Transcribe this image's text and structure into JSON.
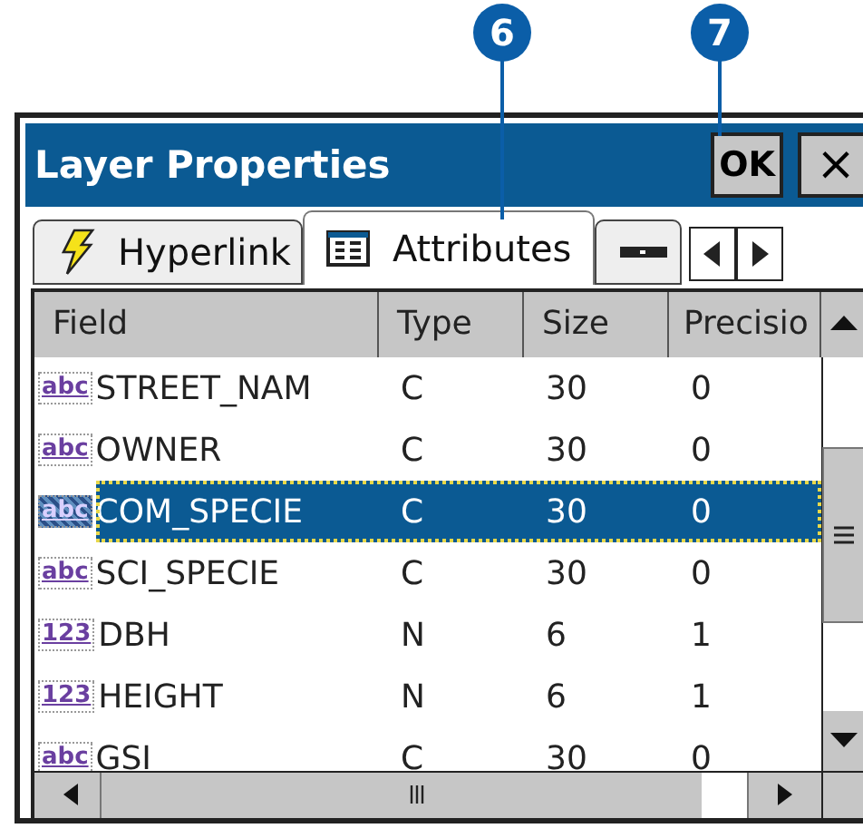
{
  "callouts": [
    {
      "number": "6"
    },
    {
      "number": "7"
    }
  ],
  "window": {
    "title": "Layer Properties",
    "buttons": [
      {
        "label": "OK",
        "kind": "ok"
      },
      {
        "label": "×",
        "kind": "close"
      }
    ]
  },
  "tabs": [
    {
      "label": "Hyperlink",
      "kind": "lightning",
      "selected": false
    },
    {
      "label": "Attributes",
      "kind": "table",
      "selected": true
    },
    {
      "kind": "bar",
      "selected": false
    }
  ],
  "table": {
    "columns": [
      "Field",
      "Type",
      "Size",
      "Precisio"
    ],
    "rows": [
      {
        "icon": "abc",
        "cells": [
          "STREET_NAM",
          "C",
          "30",
          "0"
        ],
        "selected": false
      },
      {
        "icon": "abc",
        "cells": [
          "OWNER",
          "C",
          "30",
          "0"
        ],
        "selected": false
      },
      {
        "icon": "abc",
        "cells": [
          "COM_SPECIE",
          "C",
          "30",
          "0"
        ],
        "selected": true
      },
      {
        "icon": "abc",
        "cells": [
          "SCI_SPECIE",
          "C",
          "30",
          "0"
        ],
        "selected": false
      },
      {
        "icon": "123",
        "cells": [
          "DBH",
          "N",
          "6",
          "1"
        ],
        "selected": false
      },
      {
        "icon": "123",
        "cells": [
          "HEIGHT",
          "N",
          "6",
          "1"
        ],
        "selected": false
      },
      {
        "icon": "abc",
        "cells": [
          "GSI",
          "C",
          "30",
          "0"
        ],
        "selected": false
      }
    ]
  }
}
